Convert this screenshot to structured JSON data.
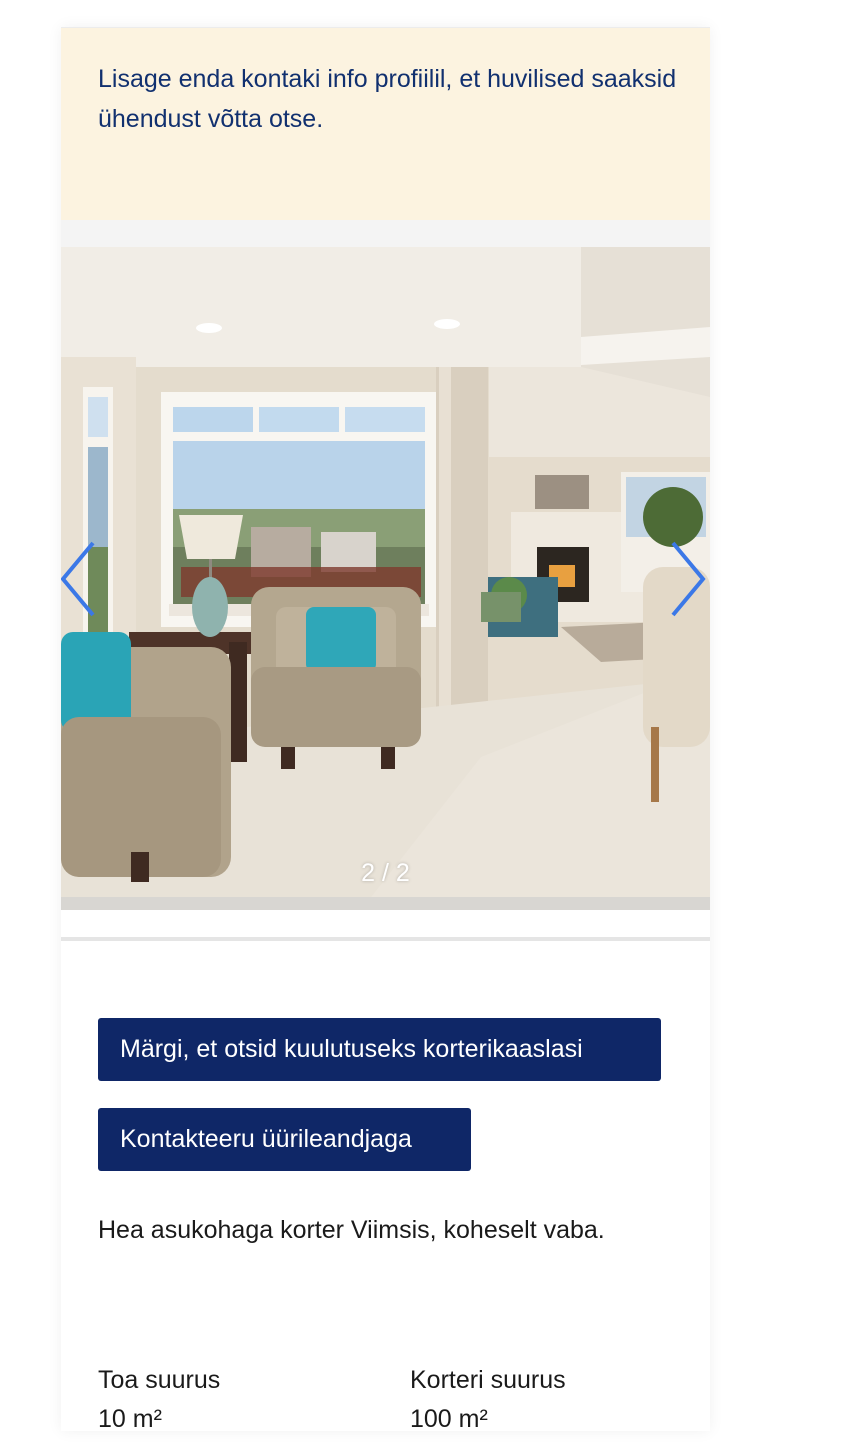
{
  "notice": {
    "text": "Lisage enda kontaki info profiilil, et huvilised saaksid ühendust võtta otse."
  },
  "gallery": {
    "counter": "2 / 2",
    "prev_icon": "chevron-left-icon",
    "next_icon": "chevron-right-icon"
  },
  "actions": {
    "roommate_label": "Märgi, et otsid kuulutuseks korterikaaslasi",
    "contact_label": "Kontakteeru üürileandjaga"
  },
  "listing": {
    "description": "Hea asukohaga korter Viimsis, koheselt vaba.",
    "room_size_label": "Toa suurus",
    "room_size_value": "10 m²",
    "apartment_size_label": "Korteri suurus",
    "apartment_size_value": "100 m²"
  },
  "colors": {
    "notice_bg": "#fcf3e0",
    "notice_text": "#11306f",
    "button_bg": "#0f2767",
    "arrow": "#3b78e7"
  }
}
